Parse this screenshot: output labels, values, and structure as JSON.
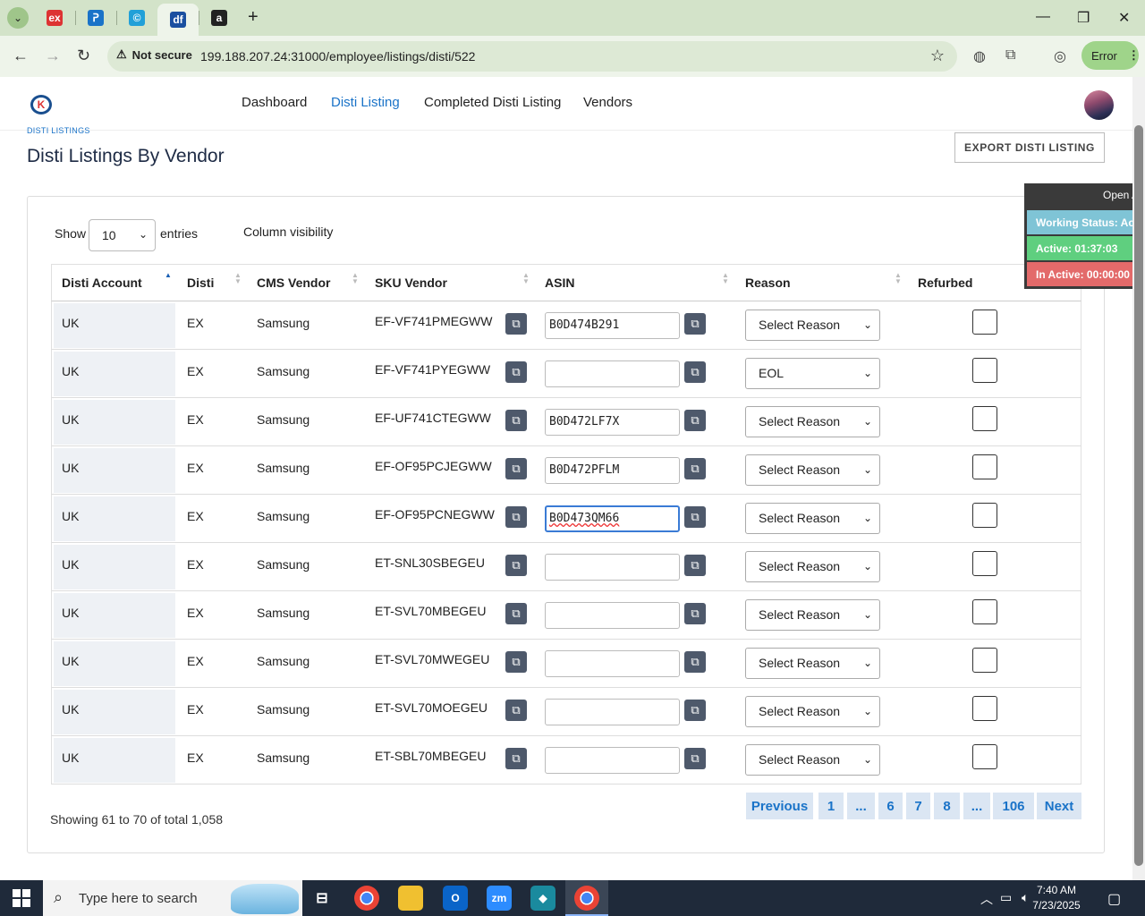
{
  "browser": {
    "tabs": [
      {
        "icon": "ex",
        "color": "#d33"
      },
      {
        "icon": "ᕈ",
        "color": "#1a73c8"
      },
      {
        "icon": "©",
        "color": "#21a0d8"
      },
      {
        "icon": "df",
        "color": "#1a4fa0"
      },
      {
        "icon": "a",
        "color": "#222"
      }
    ],
    "new_tab": "+",
    "security_label": "Not secure",
    "url": "199.188.207.24:31000/employee/listings/disti/522",
    "error_label": "Error"
  },
  "nav": {
    "links": [
      "Dashboard",
      "Disti Listing",
      "Completed Disti Listing",
      "Vendors"
    ],
    "active": "Disti Listing"
  },
  "page": {
    "breadcrumb": "DISTI LISTINGS",
    "title": "Disti Listings By Vendor",
    "export_label": "EXPORT DISTI LISTING"
  },
  "controls": {
    "show_label": "Show",
    "entries_value": "10",
    "entries_label": "entries",
    "column_visibility": "Column visibility"
  },
  "table": {
    "headers": [
      "Disti Account",
      "Disti",
      "CMS Vendor",
      "SKU Vendor",
      "ASIN",
      "Reason",
      "Refurbed"
    ],
    "rows": [
      {
        "account": "UK",
        "disti": "EX",
        "vendor": "Samsung",
        "sku": "EF-VF741PMEGWW",
        "asin": "B0D474B291",
        "reason": "Select Reason",
        "refurbed": false
      },
      {
        "account": "UK",
        "disti": "EX",
        "vendor": "Samsung",
        "sku": "EF-VF741PYEGWW",
        "asin": "",
        "reason": "EOL",
        "refurbed": false
      },
      {
        "account": "UK",
        "disti": "EX",
        "vendor": "Samsung",
        "sku": "EF-UF741CTEGWW",
        "asin": "B0D472LF7X",
        "reason": "Select Reason",
        "refurbed": false
      },
      {
        "account": "UK",
        "disti": "EX",
        "vendor": "Samsung",
        "sku": "EF-OF95PCJEGWW",
        "asin": "B0D472PFLM",
        "reason": "Select Reason",
        "refurbed": false
      },
      {
        "account": "UK",
        "disti": "EX",
        "vendor": "Samsung",
        "sku": "EF-OF95PCNEGWW",
        "asin": "B0D473QM66",
        "reason": "Select Reason",
        "refurbed": false
      },
      {
        "account": "UK",
        "disti": "EX",
        "vendor": "Samsung",
        "sku": "ET-SNL30SBEGEU",
        "asin": "",
        "reason": "Select Reason",
        "refurbed": false
      },
      {
        "account": "UK",
        "disti": "EX",
        "vendor": "Samsung",
        "sku": "ET-SVL70MBEGEU",
        "asin": "",
        "reason": "Select Reason",
        "refurbed": false
      },
      {
        "account": "UK",
        "disti": "EX",
        "vendor": "Samsung",
        "sku": "ET-SVL70MWEGEU",
        "asin": "",
        "reason": "Select Reason",
        "refurbed": false
      },
      {
        "account": "UK",
        "disti": "EX",
        "vendor": "Samsung",
        "sku": "ET-SVL70MOEGEU",
        "asin": "",
        "reason": "Select Reason",
        "refurbed": false
      },
      {
        "account": "UK",
        "disti": "EX",
        "vendor": "Samsung",
        "sku": "ET-SBL70MBEGEU",
        "asin": "",
        "reason": "Select Reason",
        "refurbed": false
      }
    ],
    "focused_row": 4
  },
  "footer": {
    "info": "Showing 61 to 70 of total 1,058",
    "pagination": [
      "Previous",
      "1",
      "...",
      "6",
      "7",
      "8",
      "...",
      "106",
      "Next"
    ]
  },
  "status_widget": {
    "open_label": "Open Ap",
    "working": "Working Status: Activ",
    "active": "Active: 01:37:03",
    "inactive": "In Active: 00:00:00",
    "colors": {
      "working": "#7fc4d6",
      "active": "#5fcf7f",
      "inactive": "#e36a6a"
    }
  },
  "taskbar": {
    "search_placeholder": "Type here to search",
    "time": "7:40 AM",
    "date": "7/23/2025"
  }
}
